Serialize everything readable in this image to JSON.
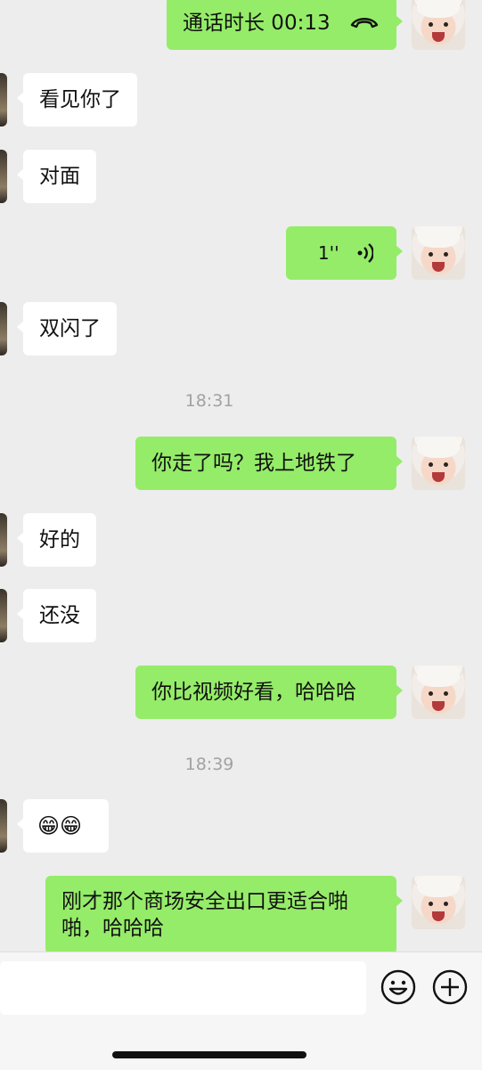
{
  "messages": {
    "call_duration": "通话时长 00:13",
    "seen_you": "看见你了",
    "opposite": "对面",
    "voice_duration": "1''",
    "hazard_lights": "双闪了",
    "time_1": "18:31",
    "left_subway": "你走了吗？我上地铁了",
    "ok": "好的",
    "not_yet": "还没",
    "prettier": "你比视频好看，哈哈哈",
    "time_2": "18:39",
    "emojis": "😁😁",
    "mall_exit": "刚才那个商场安全出口更适合啪啪，哈哈哈"
  },
  "colors": {
    "sent_bubble": "#95ec69",
    "received_bubble": "#ffffff",
    "background": "#ededed"
  },
  "icons": {
    "call": "phone-hangup-icon",
    "voice": "voice-wave-icon",
    "emoji": "emoji-icon",
    "plus": "plus-circle-icon"
  }
}
